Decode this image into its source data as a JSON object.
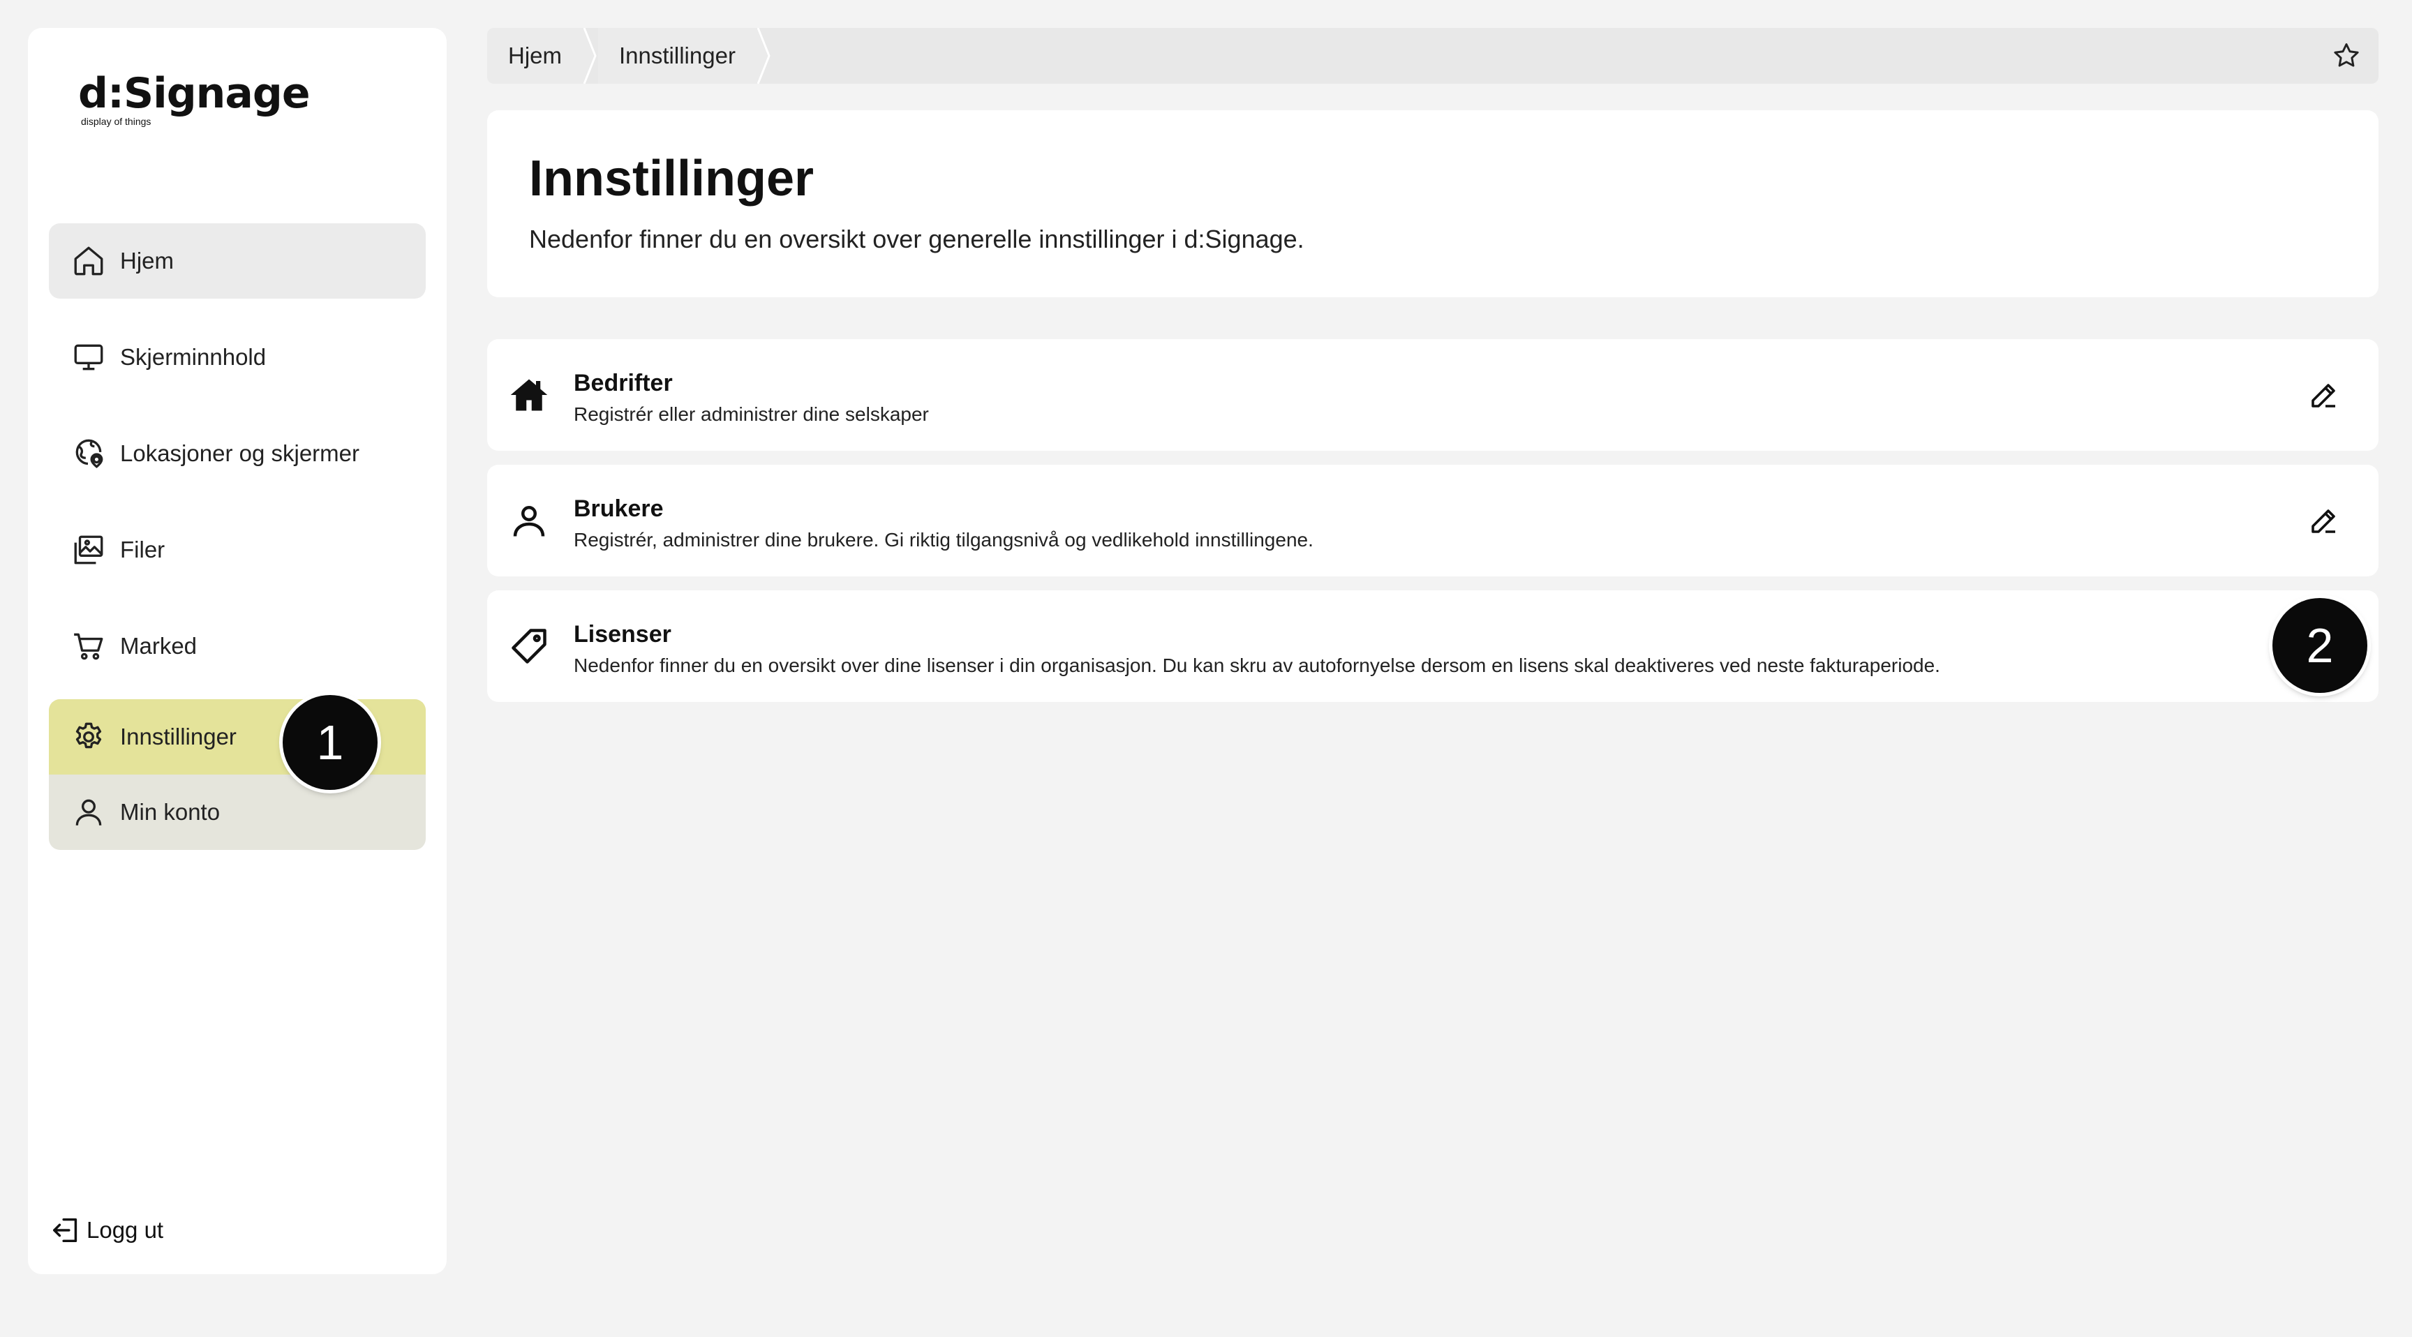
{
  "logo": {
    "name": "d:Signage",
    "tagline": "display of things"
  },
  "sidebar": {
    "items": [
      {
        "label": "Hjem",
        "icon": "home-icon"
      },
      {
        "label": "Skjerminnhold",
        "icon": "monitor-icon"
      },
      {
        "label": "Lokasjoner og skjermer",
        "icon": "location-globe-icon"
      },
      {
        "label": "Filer",
        "icon": "images-icon"
      },
      {
        "label": "Marked",
        "icon": "cart-icon"
      },
      {
        "label": "Innstillinger",
        "icon": "gear-icon"
      },
      {
        "label": "Min konto",
        "icon": "user-icon"
      }
    ],
    "logout_label": "Logg ut"
  },
  "breadcrumb": [
    "Hjem",
    "Innstillinger"
  ],
  "header": {
    "title": "Innstillinger",
    "description": "Nedenfor finner du en oversikt over generelle innstillinger i d:Signage."
  },
  "settings": [
    {
      "title": "Bedrifter",
      "description": "Registrér eller administrer dine selskaper",
      "icon": "house-icon"
    },
    {
      "title": "Brukere",
      "description": "Registrér, administrer dine brukere. Gi riktig tilgangsnivå og vedlikehold innstillingene.",
      "icon": "user-icon"
    },
    {
      "title": "Lisenser",
      "description": "Nedenfor finner du en oversikt over dine lisenser i din organisasjon. Du kan skru av autofornyelse dersom en lisens skal deaktiveres ved neste fakturaperiode.",
      "icon": "tag-icon"
    }
  ],
  "badges": [
    "1",
    "2"
  ],
  "colors": {
    "accent": "#e4e39a",
    "background": "#f3f3f3",
    "badge": "#0a0a0a"
  }
}
